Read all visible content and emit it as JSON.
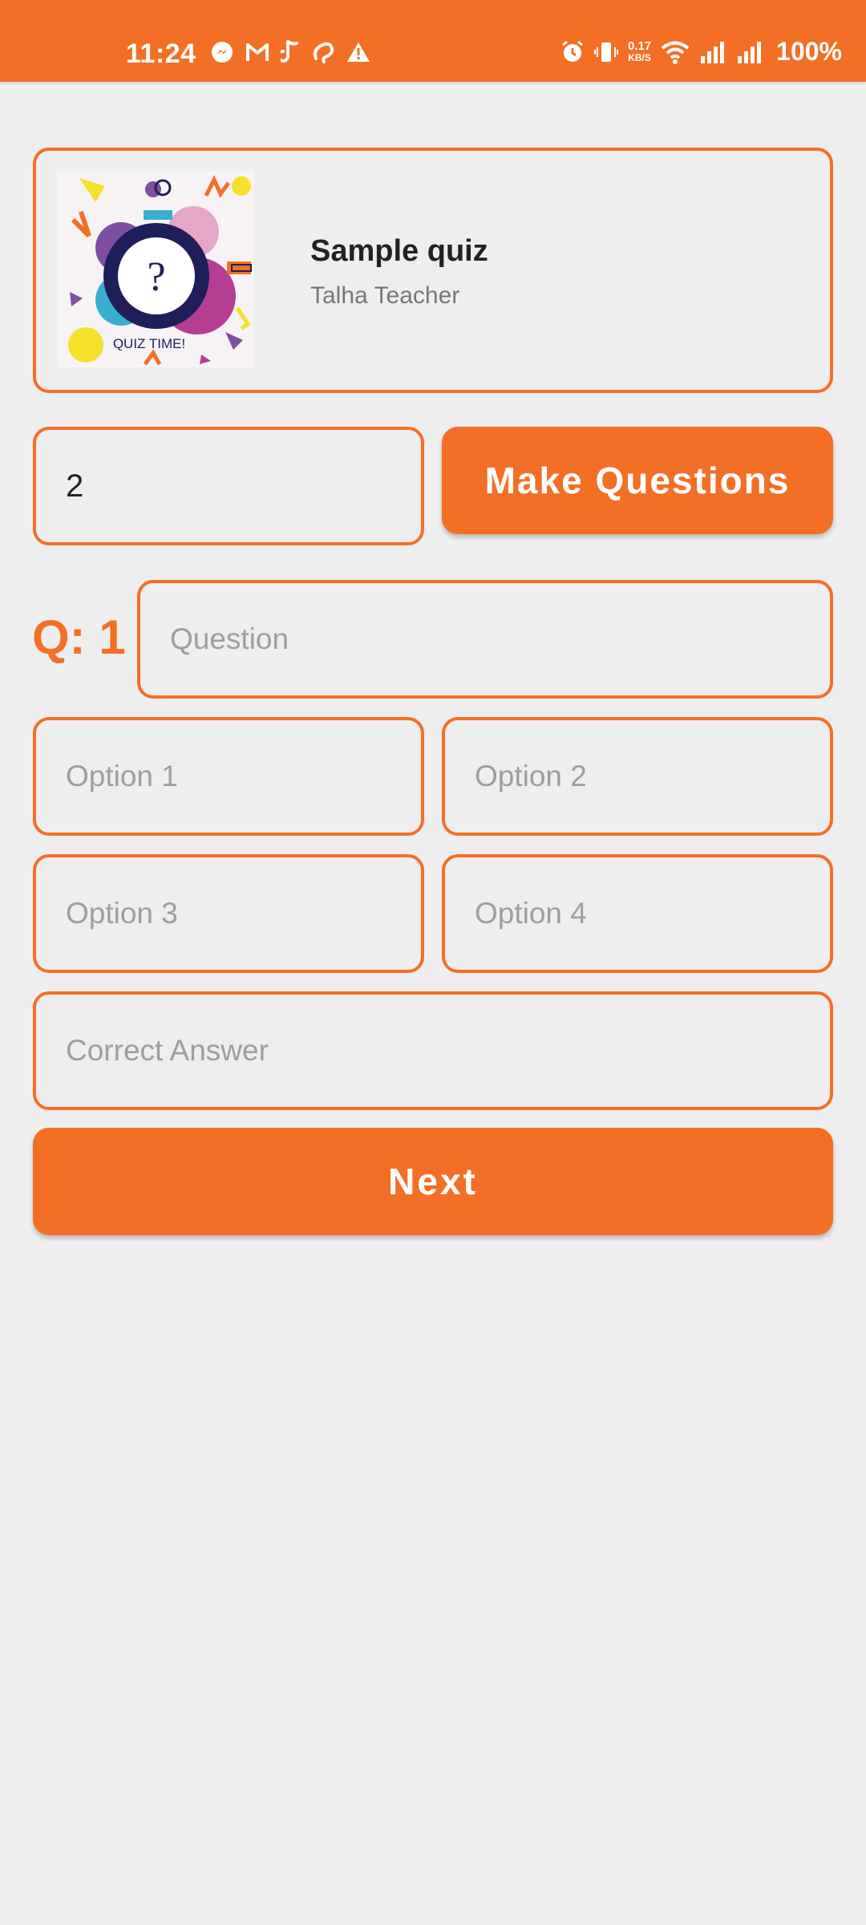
{
  "status_bar": {
    "time": "11:24",
    "speed_value": "0.17",
    "speed_unit": "KB/S",
    "battery": "100%",
    "left_icons": [
      "messenger-icon",
      "gmail-icon",
      "app-icon",
      "airtel-icon",
      "warning-icon"
    ],
    "right_icons": [
      "alarm-icon",
      "vibrate-icon",
      "wifi-icon",
      "signal-icon",
      "signal-icon"
    ],
    "color": "#f46f26"
  },
  "quiz": {
    "title": "Sample quiz",
    "author": "Talha Teacher",
    "image_caption": "QUIZ TIME!"
  },
  "controls": {
    "question_count": "2",
    "make_questions_label": "Make Questions"
  },
  "question": {
    "label": "Q: 1",
    "question_placeholder": "Question",
    "option1_placeholder": "Option 1",
    "option2_placeholder": "Option 2",
    "option3_placeholder": "Option 3",
    "option4_placeholder": "Option 4",
    "correct_answer_placeholder": "Correct Answer",
    "next_label": "Next"
  },
  "theme": {
    "accent": "#f46f26",
    "background": "#eeeeee"
  }
}
